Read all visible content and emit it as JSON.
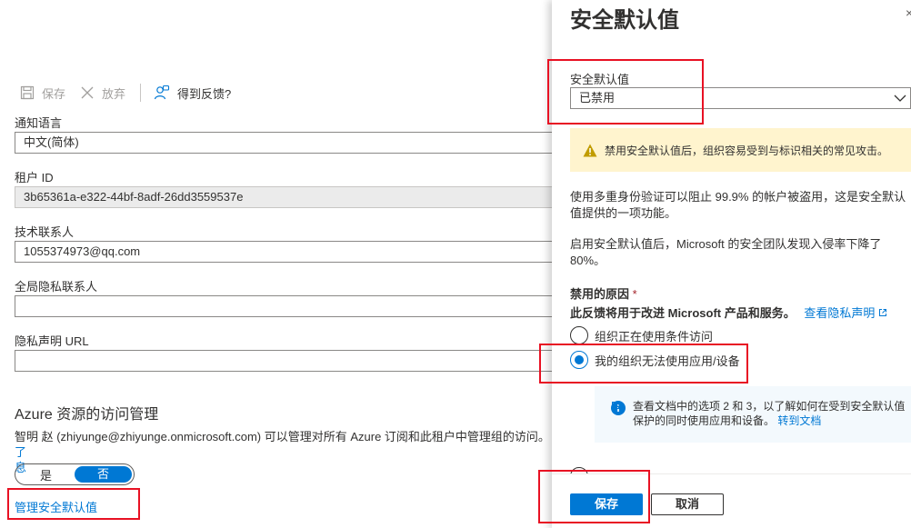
{
  "toolbar": {
    "save_label": "保存",
    "discard_label": "放弃",
    "feedback_label": "得到反馈?"
  },
  "fields": {
    "notification_language": {
      "label": "通知语言",
      "value": "中文(简体)"
    },
    "tenant_id": {
      "label": "租户 ID",
      "value": "3b65361a-e322-44bf-8adf-26dd3559537e"
    },
    "technical_contact": {
      "label": "技术联系人",
      "value": "1055374973@qq.com"
    },
    "global_privacy_contact": {
      "label": "全局隐私联系人",
      "value": ""
    },
    "privacy_statement_url": {
      "label": "隐私声明 URL",
      "value": ""
    }
  },
  "azure_access": {
    "title": "Azure 资源的访问管理",
    "text": "智明 赵 (zhiyunge@zhiyunge.onmicrosoft.com) 可以管理对所有 Azure 订阅和此租户中管理组的访问。",
    "link_fragment": "了",
    "link_tail": "息",
    "toggle_yes": "是",
    "toggle_no": "否",
    "toggle_selected": "否"
  },
  "manage_security_defaults_link": "管理安全默认值",
  "panel": {
    "title": "安全默认值",
    "close_glyph": "×",
    "dropdown_label": "安全默认值",
    "dropdown_value": "已禁用",
    "warning_text": "禁用安全默认值后，组织容易受到与标识相关的常见攻击。",
    "para1": "使用多重身份验证可以阻止 99.9% 的帐户被盗用，这是安全默认值提供的一项功能。",
    "para2": "启用安全默认值后，Microsoft 的安全团队发现入侵率下降了 80%。",
    "reason_label": "禁用的原因",
    "required_mark": "*",
    "feedback_note": "此反馈将用于改进 Microsoft 产品和服务。",
    "privacy_link": "查看隐私声明",
    "options": [
      {
        "label": "组织正在使用条件访问",
        "checked": false
      },
      {
        "label": "我的组织无法使用应用/设备",
        "checked": true
      }
    ],
    "info_text": "查看文档中的选项 2 和 3，以了解如何在受到安全默认值保护的同时使用应用和设备。",
    "info_link": "转到文档",
    "save_button": "保存",
    "cancel_button": "取消"
  },
  "colors": {
    "accent": "#0078d4",
    "highlight_box": "#e81123",
    "warning_bg": "#fff4ce",
    "warning_icon": "#c19c00",
    "info_bg": "#f3f9fd"
  }
}
